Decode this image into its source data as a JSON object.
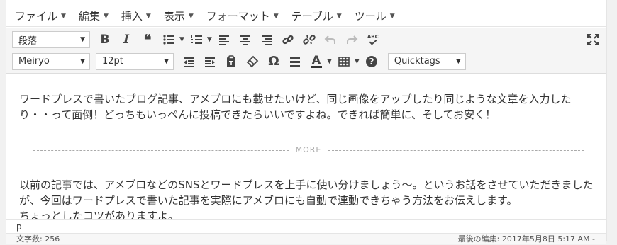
{
  "menubar": {
    "items": [
      "ファイル",
      "編集",
      "挿入",
      "表示",
      "フォーマット",
      "テーブル",
      "ツール"
    ]
  },
  "toolbar1": {
    "format_select": "段落",
    "buttons": [
      "bold",
      "italic",
      "blockquote",
      "bullet-list",
      "numbered-list",
      "align-left",
      "align-center",
      "align-right",
      "insert-link",
      "remove-link",
      "undo",
      "redo",
      "spellcheck",
      "fullscreen"
    ],
    "bold_glyph": "B",
    "italic_glyph": "I",
    "quote_glyph": "❝",
    "spell_label": "ABC"
  },
  "toolbar2": {
    "font_select": "Meiryo",
    "size_select": "12pt",
    "omega_glyph": "Ω",
    "text_color_glyph": "A",
    "quicktags_select": "Quicktags"
  },
  "content": {
    "paragraph1": "ワードプレスで書いたブログ記事、アメブロにも載せたいけど、同じ画像をアップしたり同じような文章を入力したり・・って面倒！どっちもいっぺんに投稿できたらいいですよね。できれば簡単に、そしてお安く！",
    "more_label": "MORE",
    "paragraph2": "以前の記事では、アメブロなどのSNSとワードプレスを上手に使い分けましょう～。というお話をさせていただきましたが、今回はワードプレスで書いた記事を実際にアメブロにも自動で連動できちゃう方法をお伝えします。",
    "paragraph3": "ちょっとしたコツがありますよ。"
  },
  "pathbar": {
    "path": "p"
  },
  "statusbar": {
    "word_count": "文字数: 256",
    "last_edited": "最後の編集: 2017年5月8日 5:17 AM - "
  },
  "colors": {
    "toolbar_bg": "#f5f5f5",
    "icon": "#444444",
    "disabled_icon": "#bbbbbb"
  }
}
